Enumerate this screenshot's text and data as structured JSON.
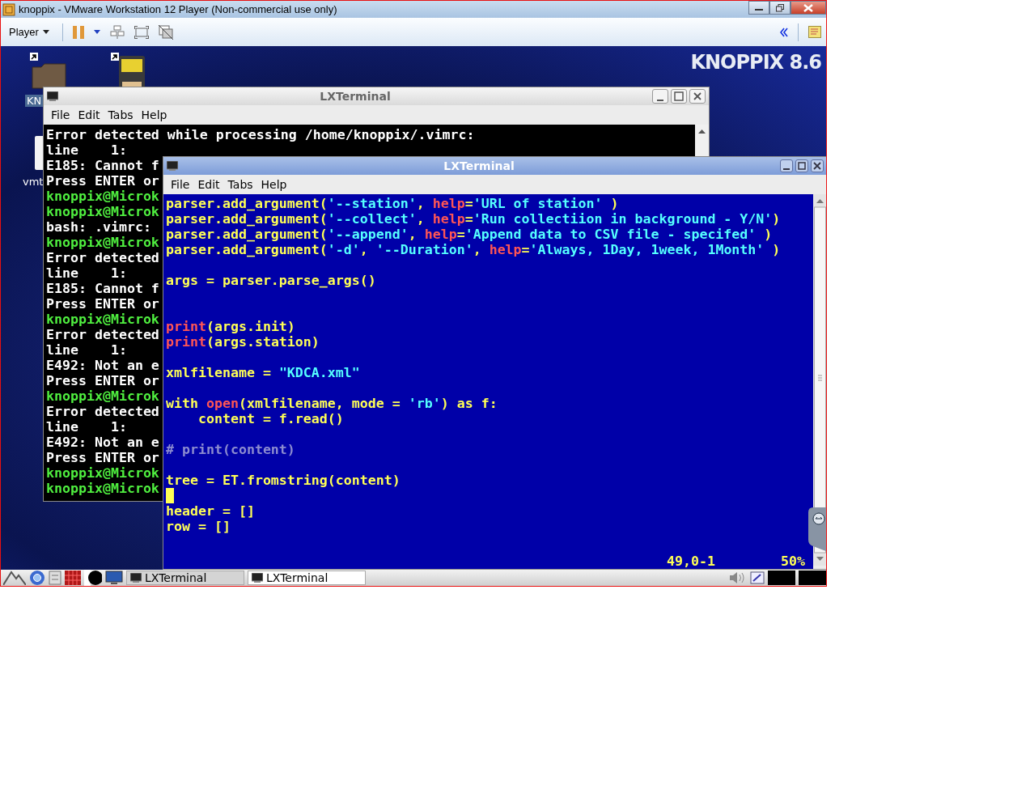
{
  "window": {
    "title": "knoppix - VMware Workstation 12 Player (Non-commercial use only)"
  },
  "toolbar": {
    "menu": "Player"
  },
  "desktop": {
    "logo": "KNOPPIX 8.6",
    "icon_labels": [
      "KN",
      "vmt"
    ]
  },
  "back_terminal": {
    "title": "LXTerminal",
    "menu": [
      "File",
      "Edit",
      "Tabs",
      "Help"
    ],
    "lines": [
      {
        "kind": "output",
        "text": "Error detected while processing /home/knoppix/.vimrc:"
      },
      {
        "kind": "output",
        "text": "line    1:"
      },
      {
        "kind": "output",
        "text": "E185: Cannot f"
      },
      {
        "kind": "output",
        "text": "Press ENTER or"
      },
      {
        "kind": "prompt",
        "text": "knoppix@Microk"
      },
      {
        "kind": "prompt",
        "text": "knoppix@Microk"
      },
      {
        "kind": "output",
        "text": "bash: .vimrc: "
      },
      {
        "kind": "prompt",
        "text": "knoppix@Microk"
      },
      {
        "kind": "output",
        "text": "Error detected"
      },
      {
        "kind": "output",
        "text": "line    1:"
      },
      {
        "kind": "output",
        "text": "E185: Cannot f"
      },
      {
        "kind": "output",
        "text": "Press ENTER or"
      },
      {
        "kind": "prompt",
        "text": "knoppix@Microk"
      },
      {
        "kind": "output",
        "text": "Error detected"
      },
      {
        "kind": "output",
        "text": "line    1:"
      },
      {
        "kind": "output",
        "text": "E492: Not an e"
      },
      {
        "kind": "output",
        "text": "Press ENTER or"
      },
      {
        "kind": "prompt",
        "text": "knoppix@Microk"
      },
      {
        "kind": "output",
        "text": "Error detected"
      },
      {
        "kind": "output",
        "text": "line    1:"
      },
      {
        "kind": "output",
        "text": "E492: Not an e"
      },
      {
        "kind": "output",
        "text": "Press ENTER or"
      },
      {
        "kind": "prompt",
        "text": "knoppix@Microk"
      },
      {
        "kind": "prompt",
        "text": "knoppix@Microk"
      }
    ]
  },
  "front_terminal": {
    "title": "LXTerminal",
    "menu": [
      "File",
      "Edit",
      "Tabs",
      "Help"
    ],
    "lines": [
      {
        "kind": "code",
        "segments": [
          {
            "kind": "plain",
            "text": "parser.add_argument("
          },
          {
            "kind": "string",
            "text": "'--station'"
          },
          {
            "kind": "plain",
            "text": ", "
          },
          {
            "kind": "keyword",
            "text": "help"
          },
          {
            "kind": "plain",
            "text": "="
          },
          {
            "kind": "string",
            "text": "'URL of station'"
          },
          {
            "kind": "plain",
            "text": " )"
          }
        ]
      },
      {
        "kind": "code",
        "segments": [
          {
            "kind": "plain",
            "text": "parser.add_argument("
          },
          {
            "kind": "string",
            "text": "'--collect'"
          },
          {
            "kind": "plain",
            "text": ", "
          },
          {
            "kind": "keyword",
            "text": "help"
          },
          {
            "kind": "plain",
            "text": "="
          },
          {
            "kind": "string",
            "text": "'Run collectiion in background - Y/N'"
          },
          {
            "kind": "plain",
            "text": ")"
          }
        ]
      },
      {
        "kind": "code",
        "segments": [
          {
            "kind": "plain",
            "text": "parser.add_argument("
          },
          {
            "kind": "string",
            "text": "'--append'"
          },
          {
            "kind": "plain",
            "text": ", "
          },
          {
            "kind": "keyword",
            "text": "help"
          },
          {
            "kind": "plain",
            "text": "="
          },
          {
            "kind": "string",
            "text": "'Append data to CSV file - specifed'"
          },
          {
            "kind": "plain",
            "text": " )"
          }
        ]
      },
      {
        "kind": "code",
        "segments": [
          {
            "kind": "plain",
            "text": "parser.add_argument("
          },
          {
            "kind": "string",
            "text": "'-d'"
          },
          {
            "kind": "plain",
            "text": ", "
          },
          {
            "kind": "string",
            "text": "'--Duration'"
          },
          {
            "kind": "plain",
            "text": ", "
          },
          {
            "kind": "keyword",
            "text": "help"
          },
          {
            "kind": "plain",
            "text": "="
          },
          {
            "kind": "string",
            "text": "'Always, 1Day, 1week, 1Month'"
          },
          {
            "kind": "plain",
            "text": " )"
          }
        ]
      },
      {
        "kind": "blank"
      },
      {
        "kind": "code",
        "segments": [
          {
            "kind": "plain",
            "text": "args = parser.parse_args()"
          }
        ]
      },
      {
        "kind": "blank"
      },
      {
        "kind": "blank"
      },
      {
        "kind": "code",
        "segments": [
          {
            "kind": "keyword",
            "text": "print"
          },
          {
            "kind": "plain",
            "text": "(args.init)"
          }
        ]
      },
      {
        "kind": "code",
        "segments": [
          {
            "kind": "keyword",
            "text": "print"
          },
          {
            "kind": "plain",
            "text": "(args.station)"
          }
        ]
      },
      {
        "kind": "blank"
      },
      {
        "kind": "code",
        "segments": [
          {
            "kind": "plain",
            "text": "xmlfilename = "
          },
          {
            "kind": "string",
            "text": "\"KDCA.xml\""
          }
        ]
      },
      {
        "kind": "blank"
      },
      {
        "kind": "code",
        "segments": [
          {
            "kind": "plain",
            "text": "with "
          },
          {
            "kind": "keyword",
            "text": "open"
          },
          {
            "kind": "plain",
            "text": "(xmlfilename, mode = "
          },
          {
            "kind": "string",
            "text": "'rb'"
          },
          {
            "kind": "plain",
            "text": ") as f:"
          }
        ]
      },
      {
        "kind": "code",
        "segments": [
          {
            "kind": "plain",
            "text": "    content = f.read()"
          }
        ]
      },
      {
        "kind": "blank"
      },
      {
        "kind": "code",
        "segments": [
          {
            "kind": "comment",
            "text": "# print(content)"
          }
        ]
      },
      {
        "kind": "blank"
      },
      {
        "kind": "code",
        "segments": [
          {
            "kind": "plain",
            "text": "tree = ET.fromstring(content)"
          }
        ]
      },
      {
        "kind": "cursor"
      },
      {
        "kind": "code",
        "segments": [
          {
            "kind": "plain",
            "text": "header = []"
          }
        ]
      },
      {
        "kind": "code",
        "segments": [
          {
            "kind": "plain",
            "text": "row = []"
          }
        ]
      },
      {
        "kind": "blank"
      }
    ],
    "ruler": {
      "position": "49,0-1",
      "percent": "50%"
    }
  },
  "taskbar": {
    "tasks": [
      {
        "label": "LXTerminal",
        "selected": false
      },
      {
        "label": "LXTerminal",
        "selected": true
      }
    ]
  }
}
